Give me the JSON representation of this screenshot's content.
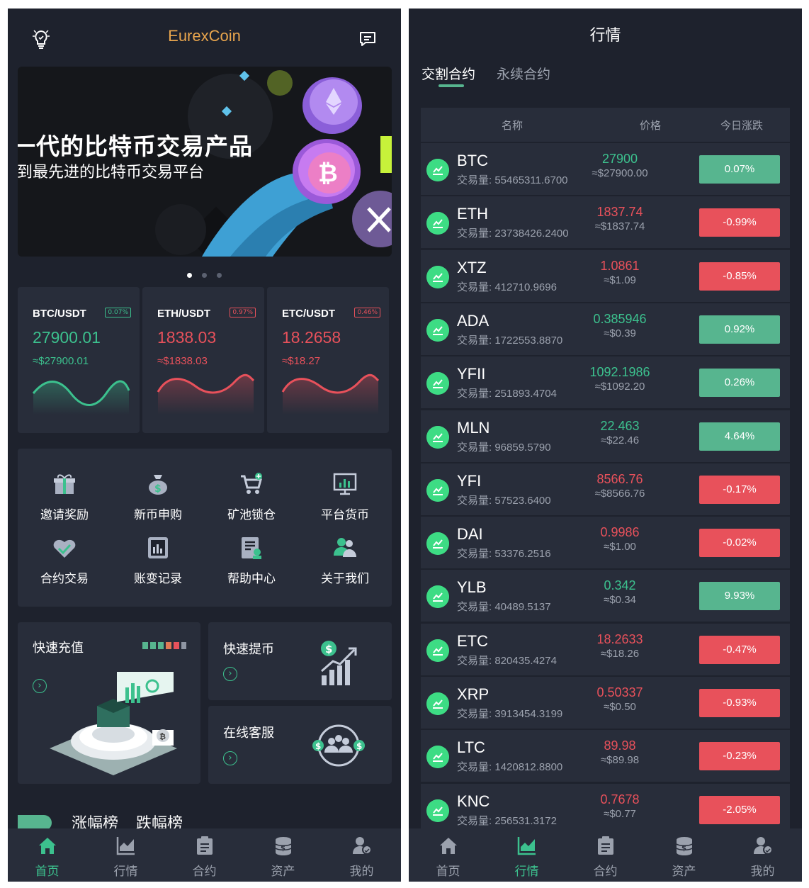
{
  "home": {
    "app_title": "EurexCoin",
    "banner": {
      "line1": "一代的比特币交易产品",
      "line2": "·到最先进的比特币交易平台"
    },
    "tickers": [
      {
        "pair": "BTC/USDT",
        "badge": "0.07%",
        "price": "27900.01",
        "approx": "≈$27900.01",
        "trend": "up"
      },
      {
        "pair": "ETH/USDT",
        "badge": "0.97%",
        "price": "1838.03",
        "approx": "≈$1838.03",
        "trend": "down"
      },
      {
        "pair": "ETC/USDT",
        "badge": "0.46%",
        "price": "18.2658",
        "approx": "≈$18.27",
        "trend": "down"
      }
    ],
    "menu": [
      {
        "label": "邀请奖励",
        "icon": "gift-icon"
      },
      {
        "label": "新币申购",
        "icon": "money-bag-icon"
      },
      {
        "label": "矿池锁仓",
        "icon": "cart-icon"
      },
      {
        "label": "平台货币",
        "icon": "monitor-chart-icon"
      },
      {
        "label": "合约交易",
        "icon": "handshake-icon"
      },
      {
        "label": "账变记录",
        "icon": "ledger-icon"
      },
      {
        "label": "帮助中心",
        "icon": "help-doc-icon"
      },
      {
        "label": "关于我们",
        "icon": "people-icon"
      }
    ],
    "quick": {
      "deposit": "快速充值",
      "withdraw": "快速提币",
      "service": "在线客服"
    },
    "rank_tabs": [
      "涨幅榜",
      "跌幅榜"
    ]
  },
  "tabs": [
    {
      "label": "首页",
      "icon": "home-icon"
    },
    {
      "label": "行情",
      "icon": "market-chart-icon"
    },
    {
      "label": "合约",
      "icon": "contract-icon"
    },
    {
      "label": "资产",
      "icon": "assets-icon"
    },
    {
      "label": "我的",
      "icon": "profile-icon"
    }
  ],
  "market": {
    "title": "行情",
    "segments": [
      "交割合约",
      "永续合约"
    ],
    "columns": [
      "名称",
      "价格",
      "今日涨跌"
    ],
    "volume_label": "交易量:",
    "rows": [
      {
        "symbol": "BTC",
        "volume": "55465311.6700",
        "price": "27900",
        "approx": "≈$27900.00",
        "change": "0.07%",
        "trend": "up"
      },
      {
        "symbol": "ETH",
        "volume": "23738426.2400",
        "price": "1837.74",
        "approx": "≈$1837.74",
        "change": "-0.99%",
        "trend": "down"
      },
      {
        "symbol": "XTZ",
        "volume": "412710.9696",
        "price": "1.0861",
        "approx": "≈$1.09",
        "change": "-0.85%",
        "trend": "down"
      },
      {
        "symbol": "ADA",
        "volume": "1722553.8870",
        "price": "0.385946",
        "approx": "≈$0.39",
        "change": "0.92%",
        "trend": "up"
      },
      {
        "symbol": "YFII",
        "volume": "251893.4704",
        "price": "1092.1986",
        "approx": "≈$1092.20",
        "change": "0.26%",
        "trend": "up"
      },
      {
        "symbol": "MLN",
        "volume": "96859.5790",
        "price": "22.463",
        "approx": "≈$22.46",
        "change": "4.64%",
        "trend": "up"
      },
      {
        "symbol": "YFI",
        "volume": "57523.6400",
        "price": "8566.76",
        "approx": "≈$8566.76",
        "change": "-0.17%",
        "trend": "down"
      },
      {
        "symbol": "DAI",
        "volume": "53376.2516",
        "price": "0.9986",
        "approx": "≈$1.00",
        "change": "-0.02%",
        "trend": "down"
      },
      {
        "symbol": "YLB",
        "volume": "40489.5137",
        "price": "0.342",
        "approx": "≈$0.34",
        "change": "9.93%",
        "trend": "up"
      },
      {
        "symbol": "ETC",
        "volume": "820435.4274",
        "price": "18.2633",
        "approx": "≈$18.26",
        "change": "-0.47%",
        "trend": "down"
      },
      {
        "symbol": "XRP",
        "volume": "3913454.3199",
        "price": "0.50337",
        "approx": "≈$0.50",
        "change": "-0.93%",
        "trend": "down"
      },
      {
        "symbol": "LTC",
        "volume": "1420812.8800",
        "price": "89.98",
        "approx": "≈$89.98",
        "change": "-0.23%",
        "trend": "down"
      },
      {
        "symbol": "KNC",
        "volume": "256531.3172",
        "price": "0.7678",
        "approx": "≈$0.77",
        "change": "-2.05%",
        "trend": "down"
      }
    ]
  },
  "colors": {
    "up": "#3cc18e",
    "down": "#e8515b",
    "accent": "#e8a54d",
    "bg": "#1e222d",
    "card": "#282d3a"
  }
}
